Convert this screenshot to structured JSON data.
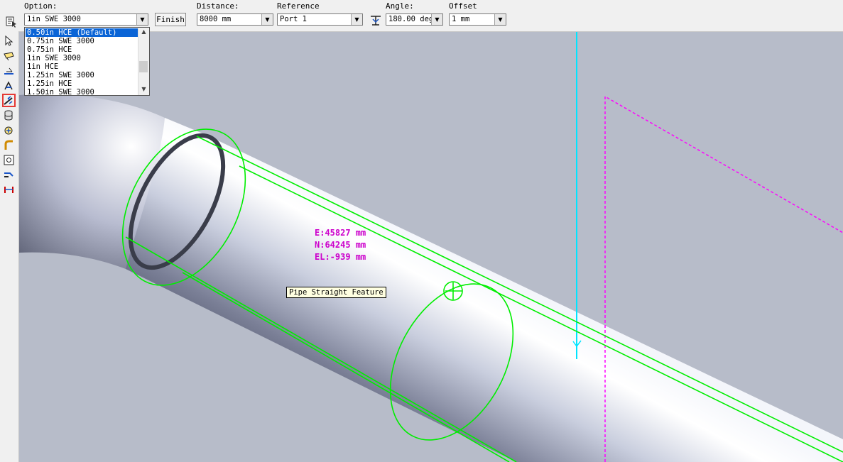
{
  "toolbar": {
    "option_label": "Option:",
    "option_value": "1in  SWE  3000",
    "finish_label": "Finish",
    "distance_label": "Distance:",
    "distance_value": "8000 mm",
    "reference_label": "Reference",
    "reference_value": "Port 1",
    "angle_label": "Angle:",
    "angle_value": "180.00 deg",
    "offset_label": "Offset",
    "offset_value": "1 mm"
  },
  "option_dropdown": {
    "items": [
      "0.50in  HCE (Default)",
      "0.75in  SWE  3000",
      "0.75in  HCE",
      "1in  SWE  3000",
      "1in  HCE",
      "1.25in  SWE  3000",
      "1.25in  HCE",
      "1.50in  SWE  3000"
    ],
    "highlighted_index": 0
  },
  "left_tools": [
    "select-arrow-icon",
    "route-pipe-icon",
    "insert-component-icon",
    "pipe-run-icon",
    "pipe-straight-feature-icon",
    "cylinder-stack-icon",
    "rotate-icon",
    "pipe-bend-icon",
    "fit-icon",
    "piping-icon",
    "weld-icon"
  ],
  "selected_tool_index": 4,
  "overlay": {
    "coord_e": "E:45827 mm",
    "coord_n": "N:64245 mm",
    "coord_el": "EL:-939 mm",
    "tooltip": "Pipe Straight Feature"
  },
  "colors": {
    "background": "#b7bcc9",
    "wireframe": "#00ee00",
    "coords_text": "#cc00cc",
    "axis_line": "#00e5ff",
    "dashed_line": "#ff00ff",
    "highlight": "#0a64d6"
  }
}
